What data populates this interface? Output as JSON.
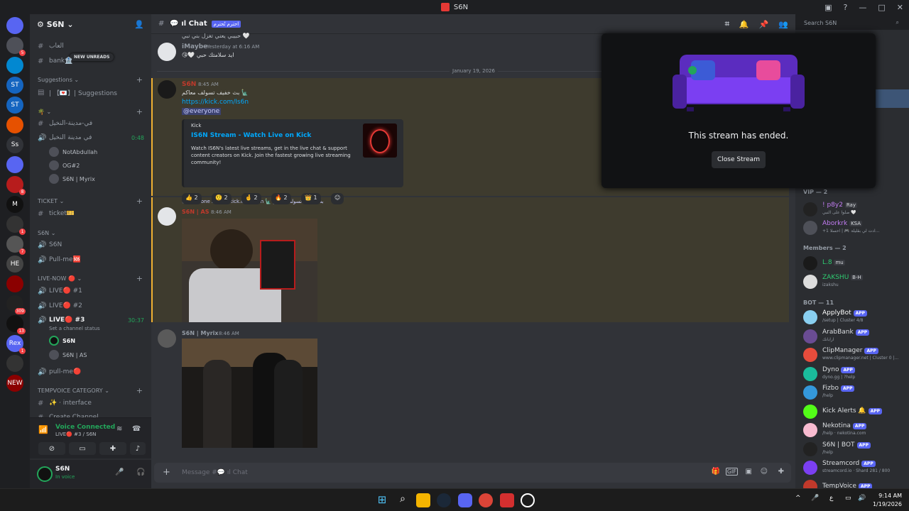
{
  "window": {
    "title": "S6N"
  },
  "servers": {
    "items": [
      {
        "name": "discord-home",
        "label": "",
        "badge": ""
      },
      {
        "name": "server-1",
        "label": "",
        "badge": "5"
      },
      {
        "name": "server-2",
        "label": "",
        "badge": ""
      },
      {
        "name": "server-st1",
        "label": "ST",
        "badge": ""
      },
      {
        "name": "server-st2",
        "label": "ST",
        "badge": ""
      },
      {
        "name": "server-3",
        "label": "",
        "badge": ""
      },
      {
        "name": "server-ss",
        "label": "Ss",
        "badge": ""
      },
      {
        "name": "server-4",
        "label": "",
        "badge": ""
      },
      {
        "name": "server-5",
        "label": "",
        "badge": "8"
      },
      {
        "name": "server-m",
        "label": "M",
        "badge": ""
      },
      {
        "name": "server-6",
        "label": "",
        "badge": "1"
      },
      {
        "name": "server-7",
        "label": "",
        "badge": "7"
      },
      {
        "name": "server-he",
        "label": "HE",
        "badge": ""
      },
      {
        "name": "server-8",
        "label": "",
        "badge": ""
      },
      {
        "name": "server-9",
        "label": "",
        "badge": "309"
      },
      {
        "name": "server-10",
        "label": "",
        "badge": "13"
      },
      {
        "name": "server-rex",
        "label": "Rex",
        "badge": "1"
      },
      {
        "name": "server-11",
        "label": "",
        "badge": ""
      },
      {
        "name": "server-new",
        "label": "NEW",
        "badge": ""
      }
    ]
  },
  "guild": {
    "name": "S6N",
    "new_unreads": "NEW UNREADS",
    "channels": {
      "games": "العاب",
      "bank": "bank🏦",
      "suggestions_cat": "Suggestions",
      "suggestions": "| 【💌】| Suggestions",
      "c1": "في-مدينة-النخيل",
      "c2": "في مدينة النخيل",
      "c2_time": "0:48",
      "vu1": "NotAbdullah",
      "vu2": "OG#2",
      "vu3": "S6N | Myrix",
      "ticket_cat": "TICKET",
      "ticket": "ticket🎫",
      "s6n_cat": "S6N",
      "s6n": "S6N",
      "pullme": "Pull-me🆘",
      "live_cat": "LIVE-NOW",
      "live1": "LIVE🔴 #1",
      "live2": "LIVE🔴 #2",
      "live3": "LIVE🔴 #3",
      "live3_time": "30:37",
      "set_status": "Set a channel status",
      "vu4": "S6N",
      "vu5": "S6N | AS",
      "pullme2": "pull-me🔴",
      "tempvoice_cat": "TEMPVOICE CATEGORY",
      "interface": "✨ · interface",
      "create": "Create Channel"
    }
  },
  "voice_panel": {
    "title": "Voice Connected",
    "sub": "LIVE🔴 #3 / S6N"
  },
  "user_panel": {
    "name": "S6N",
    "status": "In voice"
  },
  "chat": {
    "channel": "💬 ıl Chat",
    "tag": "احترم تُحترم",
    "m0_text": "حبيبي يعني تغزل بني نبي 🤍",
    "m1_name": "iMaybe",
    "m1_time": "Yesterday at 6:16 AM",
    "m1_text": "😘🤍 ايد سلامتك حبي",
    "divider": "January 19, 2026",
    "m2_name": "S6N",
    "m2_time": "8:45 AM",
    "m2_text": "بث خفيف تسولف معاكم 🗽",
    "m2_link": "https://kick.com/Is6n",
    "m2_mention": "@everyone",
    "embed_provider": "Kick",
    "embed_title": "IS6N Stream - Watch Live on Kick",
    "embed_desc": "Watch IS6N's latest live streams, get in the live chat & support content creators on Kick. Join the fastest growing live streaming community!",
    "reactions": [
      "👍 2",
      "🤨 2",
      "🤞 2",
      "🔥 2",
      "👑 1"
    ],
    "m3_reply": "@everyone https://kick.com/Is6n 🗽 بث خفيف تسولف معاكم",
    "m3_name": "S6N | AS",
    "m3_time": "8:46 AM",
    "m4_name": "S6N | Myrix",
    "m4_time": "8:46 AM",
    "input_placeholder": "Message #💬 ıl Chat"
  },
  "search": {
    "placeholder": "Search S6N"
  },
  "stream": {
    "ended": "This stream has ended.",
    "close": "Close Stream"
  },
  "members": {
    "vip_cat": "VIP — 2",
    "vip1_name": "! p8y2",
    "vip1_tag": "Ray",
    "vip1_sub": "صلوا على النبي 🤍",
    "vip2_name": "Aborkrk",
    "vip2_tag": "KSA",
    "vip2_sub": "+1 ادت لي بقليلة 🎮 | احسلا...",
    "members_cat": "Members — 2",
    "mem1_name": "L.8",
    "mem1_tag": "mu",
    "mem2_name": "ZAKSHU",
    "mem2_tag": "B-H",
    "mem2_sub": "izakshu",
    "bot_cat": "BOT — 11",
    "bots": [
      {
        "name": "ApplyBot",
        "sub": "/setup | Cluster 4/8",
        "color": "#ffffff"
      },
      {
        "name": "ArabBank",
        "sub": "ارابانك",
        "color": "#dbdee1"
      },
      {
        "name": "ClipManager",
        "sub": "www.clipmanager.net | Cluster 0 |...",
        "color": "#dbdee1"
      },
      {
        "name": "Dyno",
        "sub": "dyno.gg | ?help",
        "color": "#dbdee1"
      },
      {
        "name": "Fizbo",
        "sub": "/help",
        "color": "#dbdee1"
      },
      {
        "name": "Kick Alerts 🔔",
        "sub": "",
        "color": "#dbdee1"
      },
      {
        "name": "Nekotina",
        "sub": "/help · nekotina.com",
        "color": "#dbdee1"
      },
      {
        "name": "S6N | BOT",
        "sub": "/help",
        "color": "#dbdee1"
      },
      {
        "name": "Streamcord",
        "sub": "streamcord.io · Shard 281 / 800",
        "color": "#dbdee1"
      },
      {
        "name": "TempVoice",
        "sub": "",
        "color": "#dbdee1"
      }
    ],
    "app_label": "APP"
  },
  "taskbar": {
    "time": "9:14 AM",
    "date": "1/19/2026",
    "lang": "ع"
  }
}
